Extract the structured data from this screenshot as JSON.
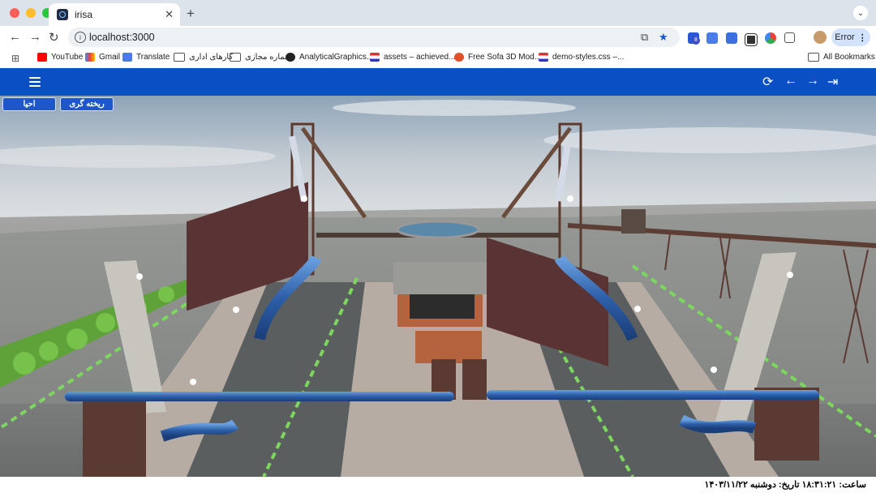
{
  "browser": {
    "tab_title": "irisa",
    "url": "localhost:3000",
    "error_label": "Error",
    "bookmarks": [
      {
        "label": "YouTube"
      },
      {
        "label": "Gmail"
      },
      {
        "label": "Translate"
      },
      {
        "label": "کارهای اداری"
      },
      {
        "label": "شماره مجازی"
      },
      {
        "label": "AnalyticalGraphics..."
      },
      {
        "label": "assets – achieved..."
      },
      {
        "label": "Free Sofa 3D Mod..."
      },
      {
        "label": "demo-styles.css –..."
      }
    ],
    "all_bookmarks": "All Bookmarks",
    "extension_badge": "8"
  },
  "app": {
    "header_color": "#0b4fc5",
    "mode_buttons": [
      {
        "label": "ریخته گری"
      },
      {
        "label": "احیا"
      }
    ]
  },
  "status_bar": {
    "text": "ساعت: ۱۸:۳۱:۲۱  تاریخ: دوشنبه ۱۴۰۳/۱۱/۲۲"
  }
}
